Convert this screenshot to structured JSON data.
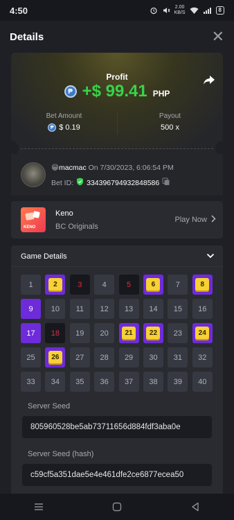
{
  "status_bar": {
    "time": "4:50",
    "network_speed": "2.00\nKB/S",
    "battery": "8"
  },
  "header": {
    "title": "Details",
    "close_glyph": "✕"
  },
  "profit": {
    "label": "Profit",
    "amount": "+$ 99.41",
    "currency": "PHP",
    "coin_symbol": "₱"
  },
  "bet": {
    "amount_label": "Bet Amount",
    "amount_value": "$ 0.19",
    "payout_label": "Payout",
    "payout_value": "500 x"
  },
  "user": {
    "emoji": "😁",
    "name": "macmac",
    "on_text": "On 7/30/2023, 6:06:54 PM",
    "bet_id_label": "Bet ID:",
    "bet_id": "334396794932848586"
  },
  "game": {
    "name": "Keno",
    "provider": "BC Originals",
    "play_label": "Play Now",
    "thumb_text": "KENO"
  },
  "game_details": {
    "title": "Game Details",
    "cells": [
      {
        "n": "1",
        "s": "n"
      },
      {
        "n": "2",
        "s": "hit"
      },
      {
        "n": "3",
        "s": "miss"
      },
      {
        "n": "4",
        "s": "n"
      },
      {
        "n": "5",
        "s": "miss"
      },
      {
        "n": "6",
        "s": "hit"
      },
      {
        "n": "7",
        "s": "n"
      },
      {
        "n": "8",
        "s": "hit"
      },
      {
        "n": "9",
        "s": "pick"
      },
      {
        "n": "10",
        "s": "n"
      },
      {
        "n": "11",
        "s": "n"
      },
      {
        "n": "12",
        "s": "n"
      },
      {
        "n": "13",
        "s": "n"
      },
      {
        "n": "14",
        "s": "n"
      },
      {
        "n": "15",
        "s": "n"
      },
      {
        "n": "16",
        "s": "n"
      },
      {
        "n": "17",
        "s": "pick"
      },
      {
        "n": "18",
        "s": "miss"
      },
      {
        "n": "19",
        "s": "n"
      },
      {
        "n": "20",
        "s": "n"
      },
      {
        "n": "21",
        "s": "hit"
      },
      {
        "n": "22",
        "s": "hit"
      },
      {
        "n": "23",
        "s": "n"
      },
      {
        "n": "24",
        "s": "hit"
      },
      {
        "n": "25",
        "s": "n"
      },
      {
        "n": "26",
        "s": "hit"
      },
      {
        "n": "27",
        "s": "n"
      },
      {
        "n": "28",
        "s": "n"
      },
      {
        "n": "29",
        "s": "n"
      },
      {
        "n": "30",
        "s": "n"
      },
      {
        "n": "31",
        "s": "n"
      },
      {
        "n": "32",
        "s": "n"
      },
      {
        "n": "33",
        "s": "n"
      },
      {
        "n": "34",
        "s": "n"
      },
      {
        "n": "35",
        "s": "n"
      },
      {
        "n": "36",
        "s": "n"
      },
      {
        "n": "37",
        "s": "n"
      },
      {
        "n": "38",
        "s": "n"
      },
      {
        "n": "39",
        "s": "n"
      },
      {
        "n": "40",
        "s": "n"
      }
    ],
    "server_seed_label": "Server Seed",
    "server_seed": "805960528be5ab73711656d884fdf3aba0e",
    "server_seed_hash_label": "Server Seed (hash)",
    "server_seed_hash": "c59cf5a351dae5e4e461dfe2ce6877ecea50"
  },
  "colors": {
    "profit_green": "#37d34a",
    "hit_purple": "#6e2bd9",
    "gem_yellow": "#f8d133",
    "miss_red": "#d6313f"
  }
}
